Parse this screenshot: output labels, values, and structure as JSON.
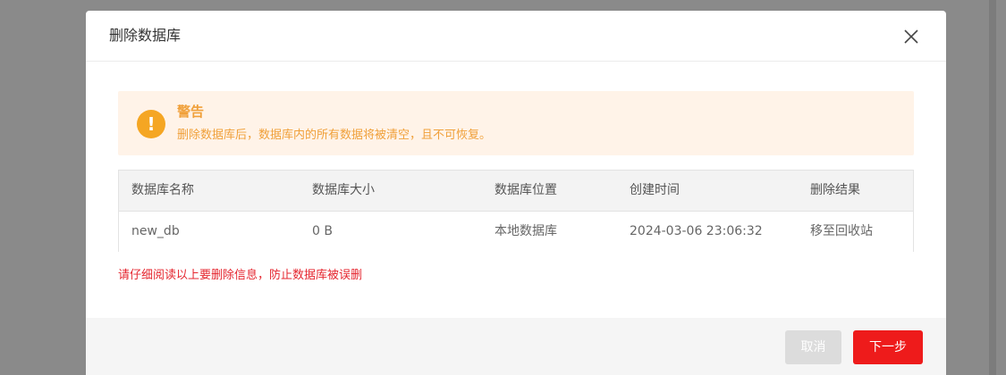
{
  "dialog": {
    "title": "删除数据库",
    "close_icon": "close-icon"
  },
  "warning": {
    "icon": "exclamation-icon",
    "title": "警告",
    "message": "删除数据库后，数据库内的所有数据将被清空，且不可恢复。"
  },
  "table": {
    "columns": [
      "数据库名称",
      "数据库大小",
      "数据库位置",
      "创建时间",
      "删除结果"
    ],
    "rows": [
      [
        "new_db",
        "0 B",
        "本地数据库",
        "2024-03-06 23:06:32",
        "移至回收站"
      ]
    ]
  },
  "note": "请仔细阅读以上要删除信息，防止数据库被误删",
  "footer": {
    "cancel_label": "取消",
    "next_label": "下一步"
  },
  "colors": {
    "overlay": "#8a8a8a",
    "warning_bg": "#fff3e8",
    "warning_text": "#f0a03a",
    "warning_icon": "#f5a623",
    "danger": "#ee1b1b",
    "note_text": "#e5262f"
  }
}
